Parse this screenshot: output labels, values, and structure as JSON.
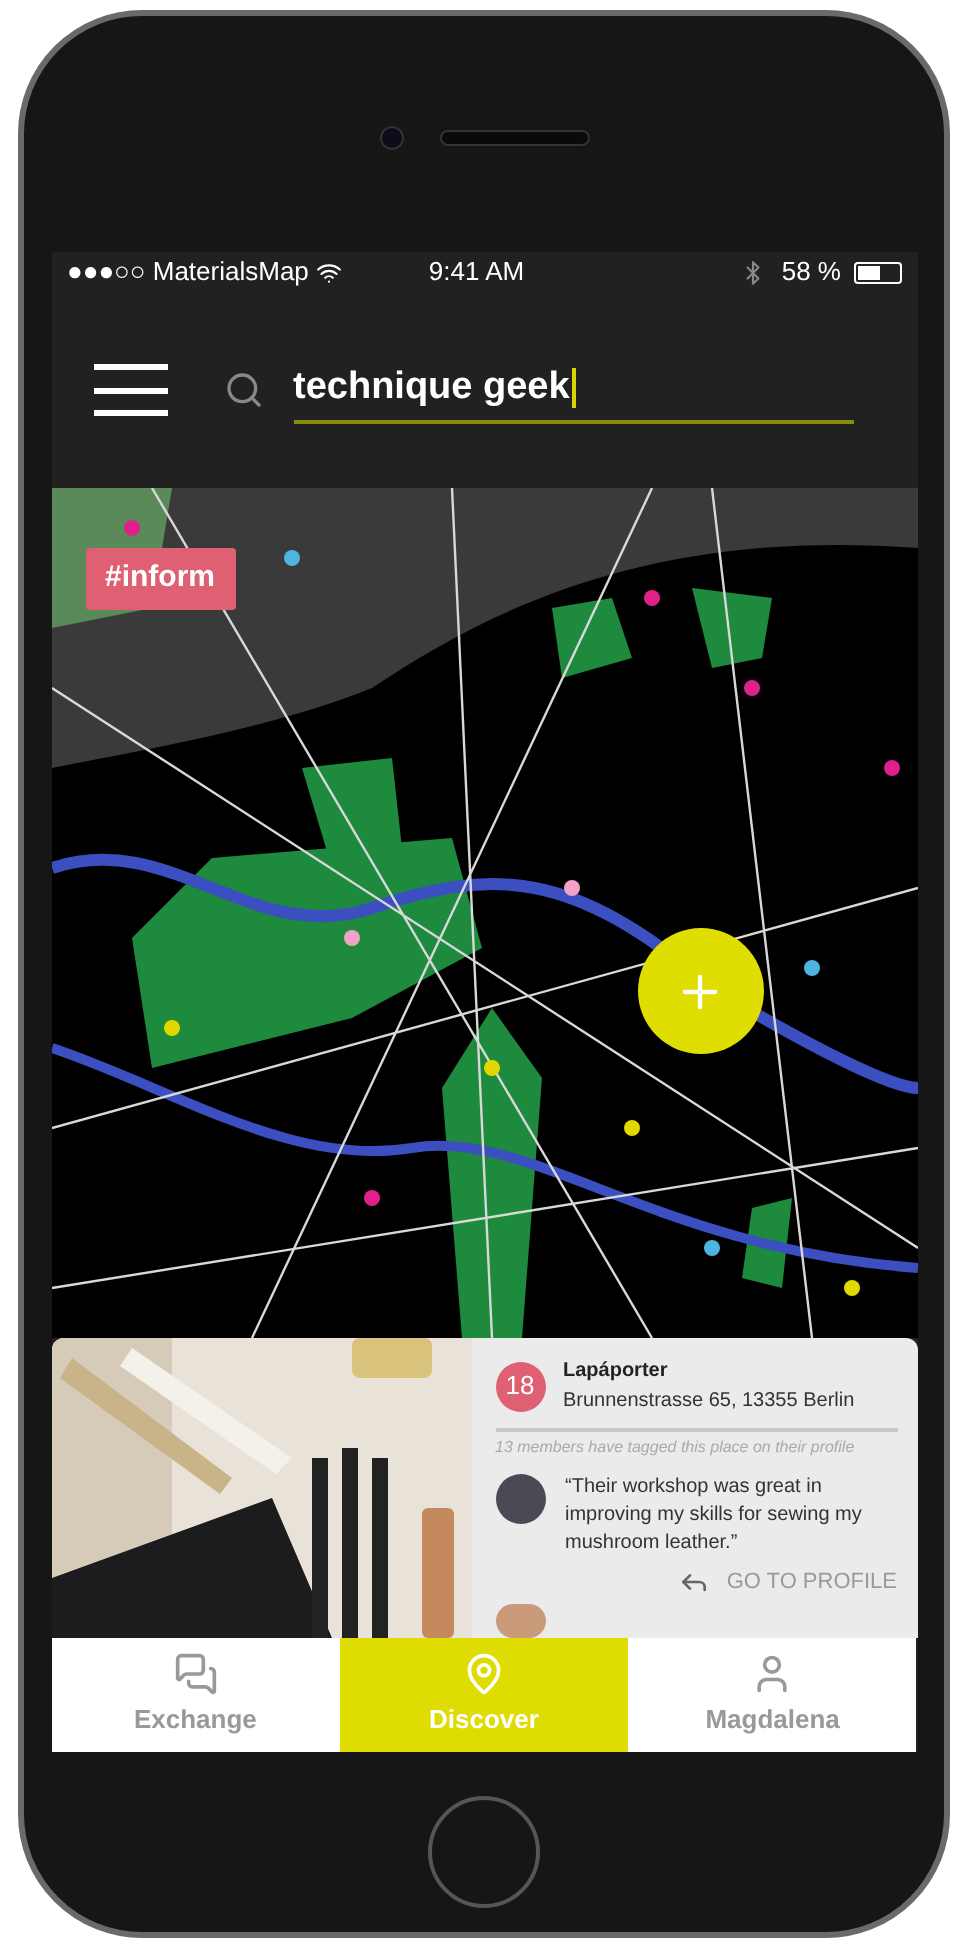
{
  "status_bar": {
    "carrier": "●●●○○ MaterialsMap",
    "time": "9:41 AM",
    "battery": "58 %"
  },
  "search": {
    "value": "technique geek"
  },
  "map": {
    "tag": "#inform"
  },
  "place_card": {
    "number": "18",
    "name": "Lapáporter",
    "address": "Brunnenstrasse 65, 13355 Berlin",
    "note": "13 members have tagged this place on their profile",
    "quote": "“Their workshop was great in improving my skills for sewing my mushroom leather.”",
    "action": "GO TO PROFILE"
  },
  "tabs": [
    {
      "label": "Exchange",
      "kind": "chat",
      "selected": false
    },
    {
      "label": "Discover",
      "kind": "pin",
      "selected": true
    },
    {
      "label": "Magdalena",
      "kind": "person",
      "selected": false
    }
  ]
}
